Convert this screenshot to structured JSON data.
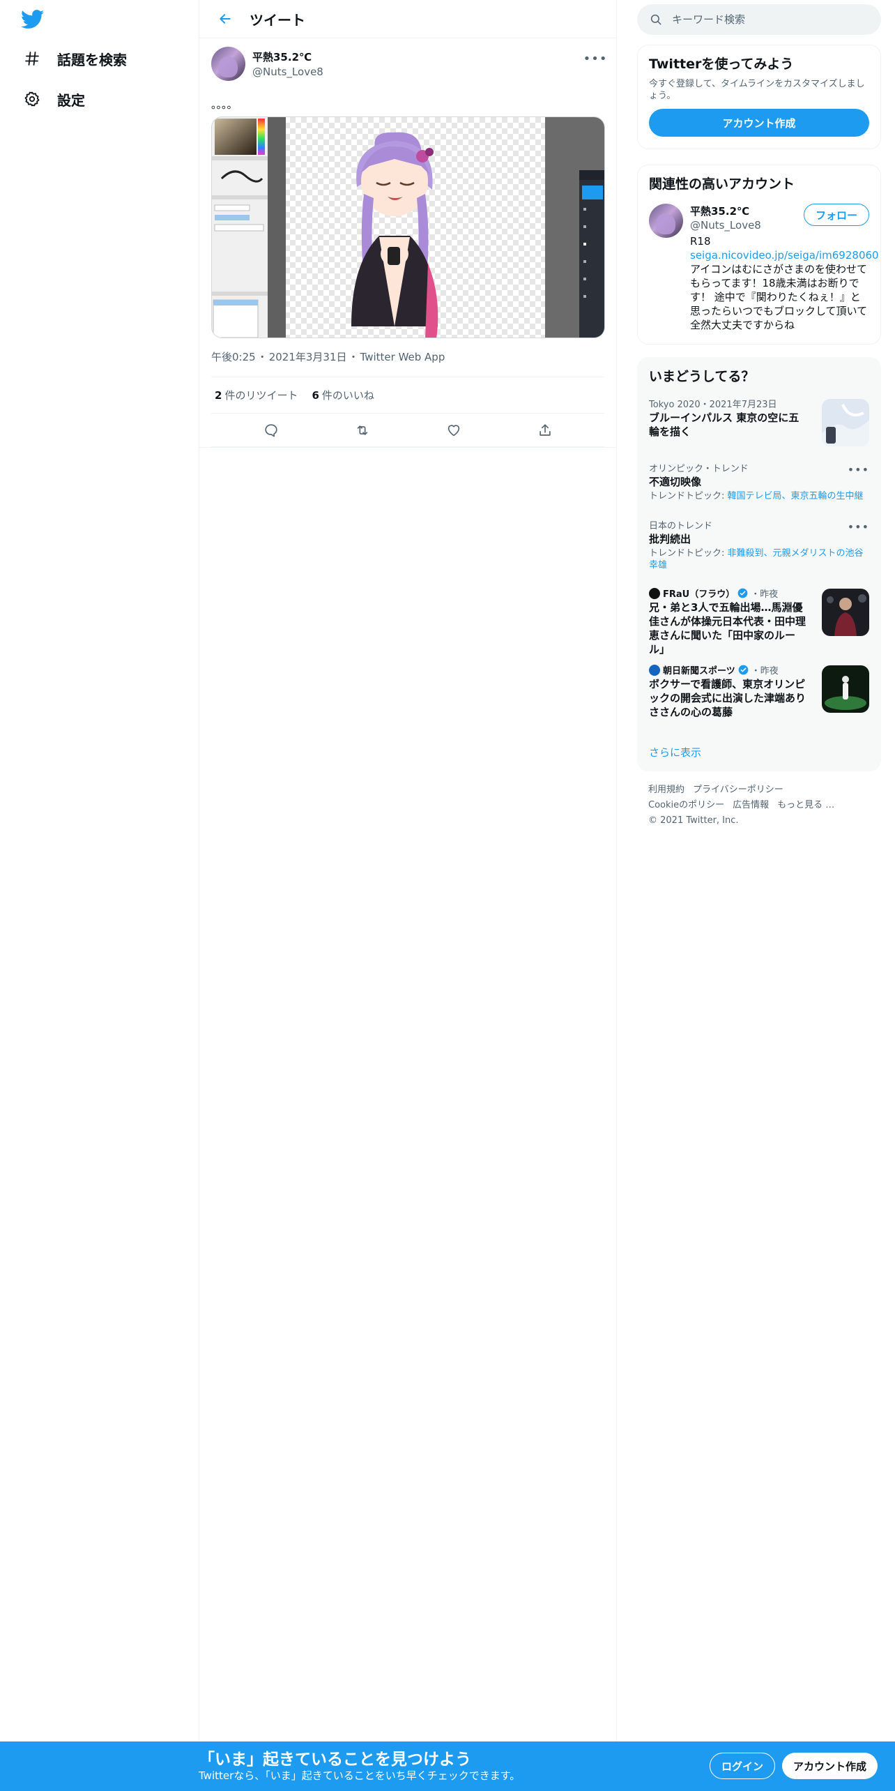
{
  "nav": {
    "items": [
      {
        "icon": "hashtag-icon",
        "label": "話題を検索"
      },
      {
        "icon": "gear-icon",
        "label": "設定"
      }
    ]
  },
  "header": {
    "title": "ツイート"
  },
  "tweet": {
    "name": "平熱35.2℃",
    "handle": "@Nuts_Love8",
    "text": "。。。。",
    "time": "午後0:25",
    "date": "2021年3月31日",
    "source": "Twitter Web App",
    "retweets": "2",
    "retweets_label": "件のリツイート",
    "likes": "6",
    "likes_label": "件のいいね"
  },
  "search": {
    "placeholder": "キーワード検索"
  },
  "signup_card": {
    "title": "Twitterを使ってみよう",
    "desc": "今すぐ登録して、タイムラインをカスタマイズしましょう。",
    "button": "アカウント作成"
  },
  "related": {
    "title": "関連性の高いアカウント",
    "name": "平熱35.2℃",
    "handle": "@Nuts_Love8",
    "bio_line1": "R18",
    "link": "seiga.nicovideo.jp/seiga/im6928060",
    "desc": "アイコンはむにさがさまのを使わせてもらってます！18歳未満はお断りです！ 途中で『関わりたくねぇ！』と思ったらいつでもブロックして頂いて全然大丈夫ですからね",
    "follow": "フォロー"
  },
  "trends": {
    "title": "いまどうしてる？",
    "items": [
      {
        "meta": "Tokyo 2020・2021年7月23日",
        "title": "ブルーインパルス 東京の空に五輪を描く"
      },
      {
        "meta": "オリンピック・トレンド",
        "title": "不適切映像",
        "sub_prefix": "トレンドトピック: ",
        "sub_links": "韓国テレビ局、東京五輪の生中継"
      },
      {
        "meta": "日本のトレンド",
        "title": "批判続出",
        "sub_prefix": "トレンドトピック: ",
        "sub_links": "非難殺到、元親メダリストの池谷幸雄"
      },
      {
        "source": "FRaU（フラウ）",
        "when": "・昨夜",
        "title": "兄・弟と3人で五輪出場…馬淵優佳さんが体操元日本代表・田中理恵さんに聞いた「田中家のルール」"
      },
      {
        "source": "朝日新聞スポーツ",
        "when": "・昨夜",
        "title": "ボクサーで看護師、東京オリンピックの開会式に出演した津端ありささんの心の葛藤"
      }
    ],
    "show_more": "さらに表示"
  },
  "footer": {
    "links": [
      "利用規約",
      "プライバシーポリシー",
      "Cookieのポリシー",
      "広告情報",
      "もっと見る …"
    ],
    "copyright": "© 2021 Twitter, Inc."
  },
  "bottom_bar": {
    "title": "「いま」起きていることを見つけよう",
    "sub": "Twitterなら、「いま」起きていることをいち早くチェックできます。",
    "login": "ログイン",
    "signup": "アカウント作成"
  },
  "colors": {
    "accent": "#1d9bf0",
    "text": "#0f1419",
    "secondary": "#536471",
    "border": "#eff3f4"
  }
}
